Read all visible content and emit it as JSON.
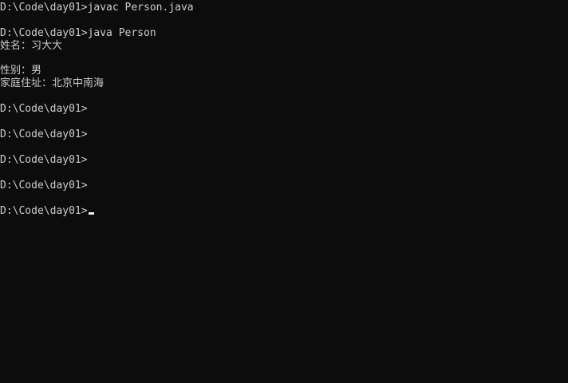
{
  "console": {
    "lines": [
      "D:\\Code\\day01>javac Person.java",
      "D:\\Code\\day01>java Person",
      "姓名：习大大",
      "性别：男",
      "家庭住址：北京中南海",
      "D:\\Code\\day01>",
      "D:\\Code\\day01>",
      "D:\\Code\\day01>",
      "D:\\Code\\day01>",
      "D:\\Code\\day01>"
    ],
    "colors": {
      "background": "#0c0c0c",
      "text": "#cccccc",
      "cursor": "#f2f2f2"
    }
  }
}
